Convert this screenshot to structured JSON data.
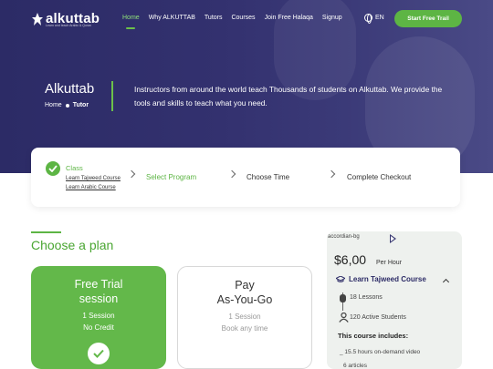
{
  "nav": {
    "logo": "alkuttab",
    "logo_tagline": "Learn and teach Arabic & Quran",
    "links": [
      "Home",
      "Why ALKUTTAB",
      "Tutors",
      "Courses",
      "Join Free Halaqa",
      "Signup"
    ],
    "active": "Home",
    "lang": "EN",
    "cta": "Start Free Trail"
  },
  "hero": {
    "title": "Alkuttab",
    "breadcrumb_home": "Home",
    "breadcrumb_current": "Tutor",
    "description": "Instructors from around the world teach Thousands of students on Alkuttab. We provide the tools and skills to teach what you need."
  },
  "steps": {
    "class_label": "Class",
    "class_options": [
      "Learn Tajweed Course",
      "Learn Arabic Course"
    ],
    "select_program": "Select Program",
    "choose_time": "Choose Time",
    "complete_checkout": "Complete Checkout"
  },
  "plans": {
    "heading": "Choose a plan",
    "free": {
      "name_line1": "Free Trial",
      "name_line2": "session",
      "line1": "1 Session",
      "line2": "No Credit"
    },
    "pay": {
      "name_line1": "Pay",
      "name_line2": "As-You-Go",
      "line1": "1 Session",
      "line2": "Book any time"
    }
  },
  "panel": {
    "image_alt": "accordian-bg",
    "price": "$6,00",
    "per": "Per Hour",
    "course": "Learn Tajweed Course",
    "lessons": "18 Lessons",
    "students": "120 Active Students",
    "includes_heading": "This course includes:",
    "includes": [
      "15.5 hours on-demand video",
      "6 articles"
    ]
  },
  "colors": {
    "brand_green": "#5db544",
    "hero_navy": "#2c2b66"
  }
}
